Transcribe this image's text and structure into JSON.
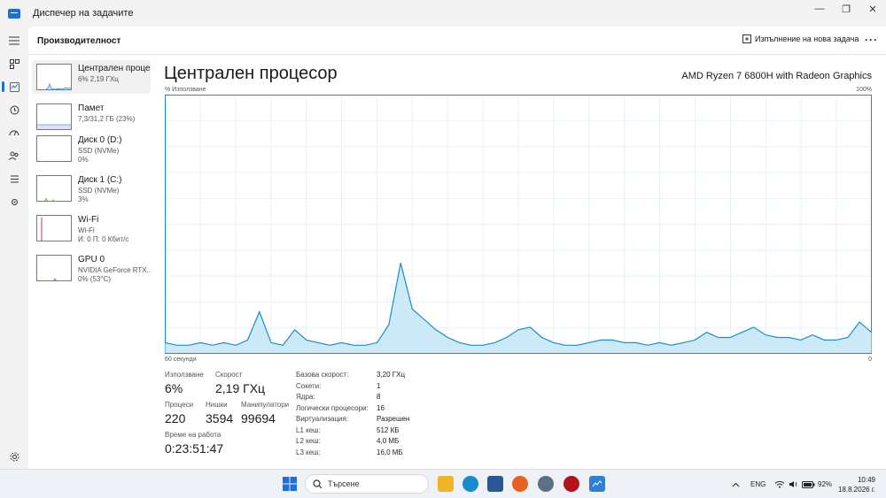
{
  "window": {
    "title": "Диспечер на задачите",
    "minimize_glyph": "—",
    "maximize_glyph": "❐",
    "close_glyph": "✕"
  },
  "rail": {
    "items": [
      {
        "icon": "hamburger-menu-icon"
      },
      {
        "icon": "processes-icon"
      },
      {
        "icon": "performance-icon"
      },
      {
        "icon": "app-history-icon"
      },
      {
        "icon": "startup-apps-icon"
      },
      {
        "icon": "users-icon"
      },
      {
        "icon": "details-icon"
      },
      {
        "icon": "services-icon"
      },
      {
        "icon": "settings-icon"
      }
    ]
  },
  "header": {
    "title": "Производителност",
    "run_task_label": "Изпълнение на нова задача",
    "more_label": "···"
  },
  "resources": [
    {
      "name": "Централен процесор",
      "sub1": "6% 2,19 ГХц",
      "sub2": "",
      "thumb": "cpu"
    },
    {
      "name": "Памет",
      "sub1": "7,3/31,2 ГБ (23%)",
      "sub2": "",
      "thumb": "memory"
    },
    {
      "name": "Диск 0 (D:)",
      "sub1": "SSD (NVMe)",
      "sub2": "0%",
      "thumb": "disk0"
    },
    {
      "name": "Диск 1 (C:)",
      "sub1": "SSD (NVMe)",
      "sub2": "3%",
      "thumb": "disk1"
    },
    {
      "name": "Wi-Fi",
      "sub1": "Wi-Fi",
      "sub2": "И: 0 П: 0 Кбит/с",
      "thumb": "wifi"
    },
    {
      "name": "GPU 0",
      "sub1": "NVIDIA GeForce RTX...",
      "sub2": "0% (53°C)",
      "thumb": "gpu"
    }
  ],
  "detail": {
    "title": "Централен процесор",
    "model": "AMD Ryzen 7 6800H with Radeon Graphics",
    "axis_top_left": "% Използване",
    "axis_top_right": "100%",
    "axis_bottom_left": "60 секунди",
    "axis_bottom_right": "0"
  },
  "chart_data": {
    "type": "area",
    "title": "",
    "xlabel": "60 секунди",
    "ylabel": "% Използване",
    "xlim": [
      60,
      0
    ],
    "ylim": [
      0,
      100
    ],
    "grid": true,
    "color": "#1a8fc9",
    "fill": "#cbe9f7",
    "values": [
      4,
      3,
      3,
      4,
      3,
      4,
      3,
      5,
      16,
      4,
      3,
      9,
      5,
      4,
      3,
      4,
      3,
      3,
      4,
      11,
      35,
      17,
      13,
      9,
      6,
      4,
      3,
      3,
      4,
      6,
      9,
      10,
      6,
      4,
      3,
      3,
      4,
      5,
      5,
      4,
      4,
      3,
      4,
      3,
      4,
      5,
      8,
      6,
      6,
      8,
      10,
      7,
      6,
      6,
      5,
      7,
      5,
      5,
      6,
      12,
      8
    ]
  },
  "stats": {
    "usage_label": "Използване",
    "usage_value": "6%",
    "speed_label": "Скорост",
    "speed_value": "2,19 ГХц",
    "processes_label": "Процеси",
    "processes_value": "220",
    "threads_label": "Нишки",
    "threads_value": "3594",
    "handles_label": "Манипулатори",
    "handles_value": "99694",
    "uptime_label": "Време на работа",
    "uptime_value": "0:23:51:47"
  },
  "properties": [
    {
      "k": "Базова скорост:",
      "v": "3,20 ГХц"
    },
    {
      "k": "Сокети:",
      "v": "1"
    },
    {
      "k": "Ядра:",
      "v": "8"
    },
    {
      "k": "Логически процесори:",
      "v": "16"
    },
    {
      "k": "Виртуализация:",
      "v": "Разрешен"
    },
    {
      "k": "L1 кеш:",
      "v": "512 КБ"
    },
    {
      "k": "L2 кеш:",
      "v": "4,0 МБ"
    },
    {
      "k": "L3 кеш:",
      "v": "16,0 МБ"
    }
  ],
  "taskbar": {
    "search_placeholder": "Търсене",
    "language": "ENG",
    "battery": "92%",
    "time": "10:49",
    "date": "18.8.2026 г.",
    "apps": [
      "start-icon",
      "file-explorer-icon",
      "edge-icon",
      "store-icon",
      "firefox-icon",
      "settings-app-icon",
      "app-red-icon",
      "task-manager-icon"
    ]
  }
}
